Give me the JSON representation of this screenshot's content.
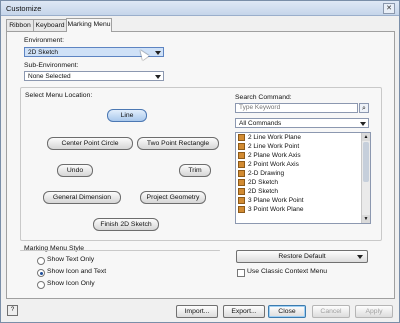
{
  "window": {
    "title": "Customize",
    "close_glyph": "✕"
  },
  "tabs": [
    {
      "label": "Ribbon"
    },
    {
      "label": "Keyboard"
    },
    {
      "label": "Marking Menu",
      "active": true
    }
  ],
  "environment": {
    "label": "Environment:",
    "value": "2D Sketch"
  },
  "sub_environment": {
    "label": "Sub-Environment:",
    "value": "None Selected"
  },
  "menu_location": {
    "label": "Select Menu Location:",
    "buttons": {
      "top": "Line",
      "upper_left": "Center Point Circle",
      "upper_right": "Two Point Rectangle",
      "left": "Undo",
      "right": "Trim",
      "lower_left": "General Dimension",
      "lower_right": "Project Geometry",
      "bottom": "Finish 2D Sketch"
    }
  },
  "search": {
    "label": "Search Command:",
    "placeholder": "Type Keyword",
    "filter": "All Commands",
    "commands": [
      "2 Line Work Plane",
      "2 Line Work Point",
      "2 Plane Work Axis",
      "2 Point Work Axis",
      "2-D Drawing",
      "2D Sketch",
      "2D Sketch",
      "3 Plane Work Point",
      "3 Point Work Plane"
    ]
  },
  "style": {
    "label": "Marking Menu Style",
    "options": [
      {
        "label": "Show Text Only",
        "selected": false
      },
      {
        "label": "Show Icon and Text",
        "selected": true
      },
      {
        "label": "Show Icon Only",
        "selected": false
      }
    ]
  },
  "restore_default": "Restore Default",
  "classic_context_menu": {
    "label": "Use Classic Context Menu",
    "checked": false
  },
  "footer": {
    "help": "?",
    "import": "Import...",
    "export": "Export...",
    "close": "Close",
    "cancel": "Cancel",
    "apply": "Apply"
  },
  "colors": {
    "accent": "#5d84c2",
    "selected_pill": "#a9c8ec"
  }
}
